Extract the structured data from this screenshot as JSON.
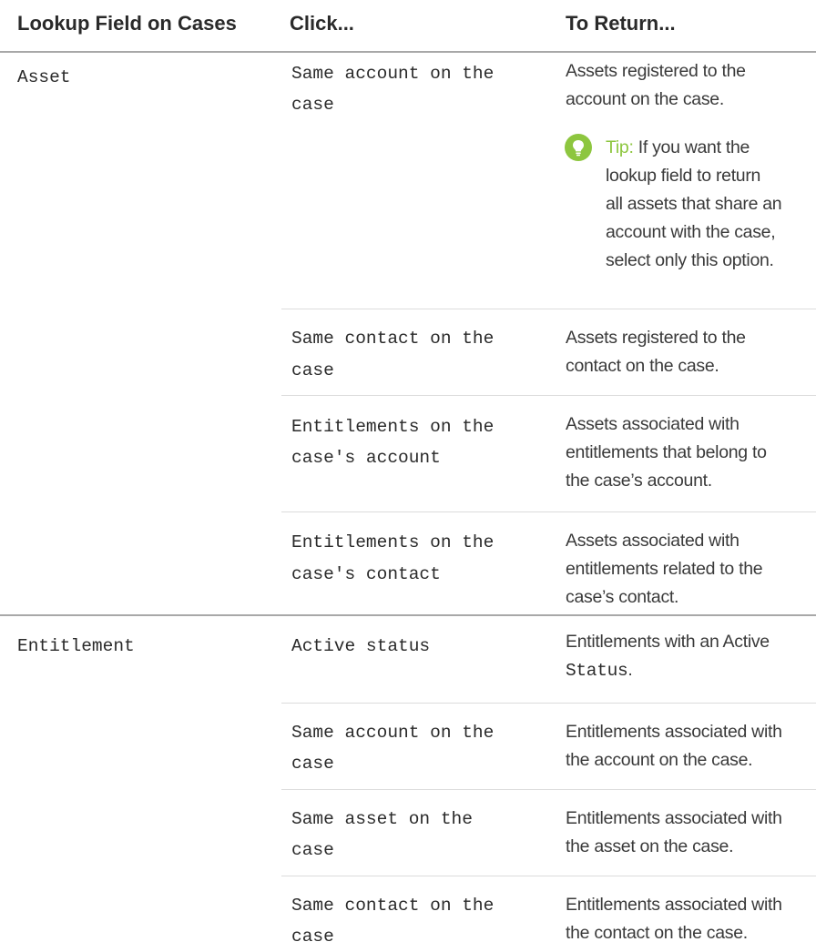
{
  "table": {
    "headers": [
      "Lookup Field on Cases",
      "Click...",
      "To Return..."
    ],
    "lookup_asset": "Asset",
    "lookup_entitlement": "Entitlement",
    "rows": [
      {
        "click": [
          "Same account on the",
          "case"
        ],
        "ret": [
          "Assets registered to the",
          "account on the case."
        ]
      },
      {
        "click": [
          "Same contact on the",
          "case"
        ],
        "ret": [
          "Assets registered to the",
          "contact on the case."
        ]
      },
      {
        "click": [
          "Entitlements on the",
          "case's account"
        ],
        "ret": [
          "Assets associated with",
          "entitlements that belong to",
          "the case’s account."
        ]
      },
      {
        "click": [
          "Entitlements on the",
          "case's contact"
        ],
        "ret": [
          "Assets associated with",
          "entitlements related to the",
          "case’s contact."
        ]
      },
      {
        "click": [
          "Active status"
        ],
        "ret": [
          "Entitlements with an Active"
        ],
        "ret_code": "Status",
        "ret_code_suffix": "."
      },
      {
        "click": [
          "Same account on the",
          "case"
        ],
        "ret": [
          "Entitlements associated with",
          "the account on the case."
        ]
      },
      {
        "click": [
          "Same asset on the",
          "case"
        ],
        "ret": [
          "Entitlements associated with",
          "the asset on the case."
        ]
      },
      {
        "click": [
          "Same contact on the",
          "case"
        ],
        "ret": [
          "Entitlements associated with",
          "the contact on the case."
        ]
      }
    ],
    "tip": {
      "icon": "lightbulb-icon",
      "label": "Tip:",
      "lines": [
        "If you want the",
        "lookup field to return",
        "all assets that share an",
        "account with the case,",
        "select only this option."
      ],
      "icon_color": "#8dc63f"
    }
  }
}
